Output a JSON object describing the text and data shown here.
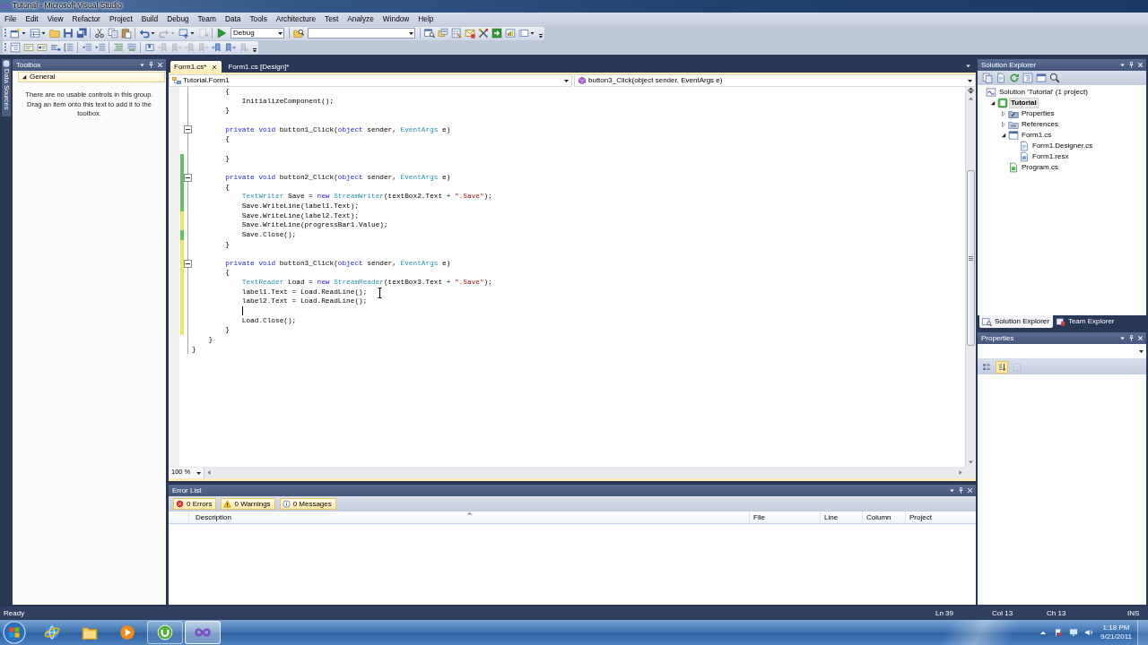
{
  "window": {
    "title": "Tutorial - Microsoft Visual Studio"
  },
  "menu": [
    "File",
    "Edit",
    "View",
    "Refactor",
    "Project",
    "Build",
    "Debug",
    "Team",
    "Data",
    "Tools",
    "Architecture",
    "Test",
    "Analyze",
    "Window",
    "Help"
  ],
  "toolbars": [
    {
      "items": [
        {
          "kind": "button",
          "dropdown": true,
          "disabled": false
        },
        {
          "kind": "button",
          "dropdown": true,
          "disabled": false
        },
        {
          "kind": "button",
          "dropdown": false,
          "disabled": false
        },
        {
          "kind": "button",
          "dropdown": false,
          "disabled": false
        },
        {
          "kind": "button",
          "dropdown": false,
          "disabled": false
        },
        {
          "kind": "separator"
        },
        {
          "kind": "button",
          "dropdown": false,
          "disabled": false
        },
        {
          "kind": "button",
          "dropdown": false,
          "disabled": false
        },
        {
          "kind": "button",
          "dropdown": false,
          "disabled": false
        },
        {
          "kind": "separator"
        },
        {
          "kind": "button",
          "dropdown": true,
          "disabled": false
        },
        {
          "kind": "button",
          "dropdown": true,
          "disabled": true
        },
        {
          "kind": "button",
          "dropdown": true,
          "disabled": false
        },
        {
          "kind": "button",
          "dropdown": false,
          "disabled": true
        },
        {
          "kind": "separator"
        },
        {
          "kind": "button",
          "dropdown": false,
          "disabled": false
        },
        {
          "kind": "combo",
          "value": "Debug"
        },
        {
          "kind": "separator"
        },
        {
          "kind": "button",
          "dropdown": false,
          "disabled": false
        },
        {
          "kind": "combo"
        },
        {
          "kind": "separator"
        },
        {
          "kind": "button",
          "dropdown": false,
          "disabled": false
        },
        {
          "kind": "button",
          "dropdown": false,
          "disabled": false
        },
        {
          "kind": "button",
          "dropdown": false,
          "disabled": false
        },
        {
          "kind": "button",
          "dropdown": false,
          "disabled": false
        },
        {
          "kind": "button",
          "dropdown": false,
          "disabled": false
        },
        {
          "kind": "button",
          "dropdown": false,
          "disabled": false
        },
        {
          "kind": "button",
          "dropdown": false,
          "disabled": false
        },
        {
          "kind": "button",
          "dropdown": true,
          "disabled": false
        },
        {
          "kind": "overflow"
        }
      ]
    },
    {
      "items": [
        {
          "kind": "button",
          "dropdown": false,
          "disabled": false
        },
        {
          "kind": "button",
          "dropdown": false,
          "disabled": false
        },
        {
          "kind": "button",
          "dropdown": false,
          "disabled": false
        },
        {
          "kind": "button",
          "dropdown": false,
          "disabled": false
        },
        {
          "kind": "button",
          "dropdown": false,
          "disabled": false
        },
        {
          "kind": "separator"
        },
        {
          "kind": "button",
          "dropdown": false,
          "disabled": false
        },
        {
          "kind": "button",
          "dropdown": false,
          "disabled": false
        },
        {
          "kind": "separator"
        },
        {
          "kind": "button",
          "dropdown": false,
          "disabled": false
        },
        {
          "kind": "button",
          "dropdown": false,
          "disabled": false
        },
        {
          "kind": "separator"
        },
        {
          "kind": "button",
          "dropdown": false,
          "disabled": false
        },
        {
          "kind": "button",
          "dropdown": false,
          "disabled": true
        },
        {
          "kind": "button",
          "dropdown": false,
          "disabled": true
        },
        {
          "kind": "button",
          "dropdown": false,
          "disabled": true
        },
        {
          "kind": "button",
          "dropdown": false,
          "disabled": true
        },
        {
          "kind": "button",
          "dropdown": false,
          "disabled": false
        },
        {
          "kind": "button",
          "dropdown": false,
          "disabled": false
        },
        {
          "kind": "button",
          "dropdown": false,
          "disabled": true
        },
        {
          "kind": "overflow"
        }
      ]
    }
  ],
  "left_dock": {
    "tabs": [
      "Data Sources"
    ]
  },
  "toolbox": {
    "title": "Toolbox",
    "groups": [
      {
        "label": "General",
        "expanded": true,
        "message": "There are no usable controls in this group. Drag an item onto this text to add it to the toolbox."
      }
    ]
  },
  "editor": {
    "tabs": [
      {
        "label": "Form1.cs*",
        "selected": true
      },
      {
        "label": "Form1.cs [Design]*",
        "selected": false
      }
    ],
    "type_selector": "Tutorial.Form1",
    "member_selector": "button3_Click(object sender, EventArgs e)",
    "lines": [
      {
        "tokens": [
          {
            "text": "        {",
            "kind": "plain"
          }
        ],
        "fold": false,
        "caret": false
      },
      {
        "tokens": [
          {
            "text": "            InitializeComponent();",
            "kind": "plain"
          }
        ],
        "fold": false,
        "caret": false
      },
      {
        "tokens": [
          {
            "text": "        }",
            "kind": "plain"
          }
        ],
        "fold": false,
        "caret": false
      },
      {
        "fold": false,
        "caret": false
      },
      {
        "tokens": [
          {
            "text": "        private void",
            "kind": "keyword"
          },
          {
            "text": " button1_Click(",
            "kind": "plain"
          },
          {
            "text": "object",
            "kind": "keyword"
          },
          {
            "text": " sender, ",
            "kind": "plain"
          },
          {
            "text": "EventArgs",
            "kind": "type"
          },
          {
            "text": " e)",
            "kind": "plain"
          }
        ],
        "fold": true,
        "caret": false
      },
      {
        "tokens": [
          {
            "text": "        {",
            "kind": "plain"
          }
        ],
        "fold": false,
        "caret": false
      },
      {
        "fold": false,
        "caret": false
      },
      {
        "tokens": [
          {
            "text": "        }",
            "kind": "plain"
          }
        ],
        "color": "#5fc561",
        "fold": false,
        "caret": false
      },
      {
        "color": "#5fc561",
        "fold": false,
        "caret": false
      },
      {
        "tokens": [
          {
            "text": "        private void",
            "kind": "keyword"
          },
          {
            "text": " button2_Click(",
            "kind": "plain"
          },
          {
            "text": "object",
            "kind": "keyword"
          },
          {
            "text": " sender, ",
            "kind": "plain"
          },
          {
            "text": "EventArgs",
            "kind": "type"
          },
          {
            "text": " e)",
            "kind": "plain"
          }
        ],
        "color": "#5fc561",
        "fold": true,
        "caret": false
      },
      {
        "tokens": [
          {
            "text": "        {",
            "kind": "plain"
          }
        ],
        "color": "#5fc561",
        "fold": false,
        "caret": false
      },
      {
        "tokens": [
          {
            "text": "            TextWriter",
            "kind": "type"
          },
          {
            "text": " Save = ",
            "kind": "plain"
          },
          {
            "text": "new",
            "kind": "keyword"
          },
          {
            "text": " StreamWriter",
            "kind": "type"
          },
          {
            "text": "(textBox2.Text + ",
            "kind": "plain"
          },
          {
            "text": "\".Save\"",
            "kind": "string"
          },
          {
            "text": ");",
            "kind": "plain"
          }
        ],
        "color": "#5fc561",
        "fold": false,
        "caret": false
      },
      {
        "tokens": [
          {
            "text": "            Save.WriteLine(label1.Text);",
            "kind": "plain"
          }
        ],
        "color": "#5fc561",
        "fold": false,
        "caret": false
      },
      {
        "tokens": [
          {
            "text": "            Save.WriteLine(label2.Text);",
            "kind": "plain"
          }
        ],
        "color": "#ede66b",
        "fold": false,
        "caret": false
      },
      {
        "tokens": [
          {
            "text": "            Save.WriteLine(progressBar1.Value);",
            "kind": "plain"
          }
        ],
        "color": "#ede66b",
        "fold": false,
        "caret": false
      },
      {
        "tokens": [
          {
            "text": "            Save.Close();",
            "kind": "plain"
          }
        ],
        "color": "#5fc561",
        "fold": false,
        "caret": false
      },
      {
        "tokens": [
          {
            "text": "        }",
            "kind": "plain"
          }
        ],
        "color": "#ede66b",
        "fold": false,
        "caret": false
      },
      {
        "color": "#ede66b",
        "fold": false,
        "caret": false
      },
      {
        "tokens": [
          {
            "text": "        private void",
            "kind": "keyword"
          },
          {
            "text": " button3_Click(",
            "kind": "plain"
          },
          {
            "text": "object",
            "kind": "keyword"
          },
          {
            "text": " sender, ",
            "kind": "plain"
          },
          {
            "text": "EventArgs",
            "kind": "type"
          },
          {
            "text": " e)",
            "kind": "plain"
          }
        ],
        "color": "#ede66b",
        "fold": true,
        "caret": false
      },
      {
        "tokens": [
          {
            "text": "        {",
            "kind": "plain"
          }
        ],
        "color": "#ede66b",
        "fold": false,
        "caret": false
      },
      {
        "tokens": [
          {
            "text": "            TextReader",
            "kind": "type"
          },
          {
            "text": " Load = ",
            "kind": "plain"
          },
          {
            "text": "new",
            "kind": "keyword"
          },
          {
            "text": " StreamReader",
            "kind": "type"
          },
          {
            "text": "(textBox3.Text + ",
            "kind": "plain"
          },
          {
            "text": "\".Save\"",
            "kind": "string"
          },
          {
            "text": ");",
            "kind": "plain"
          }
        ],
        "color": "#ede66b",
        "fold": false,
        "caret": false
      },
      {
        "tokens": [
          {
            "text": "            label1.Text = Load.ReadLine();",
            "kind": "plain"
          }
        ],
        "color": "#ede66b",
        "fold": false,
        "caret": false
      },
      {
        "tokens": [
          {
            "text": "            label2.Text = Load.ReadLine();",
            "kind": "plain"
          }
        ],
        "color": "#ede66b",
        "fold": false,
        "caret": false
      },
      {
        "color": "#ede66b",
        "fold": false,
        "caret": true
      },
      {
        "tokens": [
          {
            "text": "            Load.Close();",
            "kind": "plain"
          }
        ],
        "color": "#ede66b",
        "fold": false,
        "caret": false
      },
      {
        "tokens": [
          {
            "text": "        }",
            "kind": "plain"
          }
        ],
        "color": "#ede66b",
        "fold": false,
        "caret": false
      },
      {
        "tokens": [
          {
            "text": "    }",
            "kind": "plain"
          }
        ],
        "fold": false,
        "caret": false
      },
      {
        "tokens": [
          {
            "text": "}",
            "kind": "plain"
          }
        ],
        "fold": false,
        "caret": false
      }
    ],
    "zoom": "100 %"
  },
  "error_list": {
    "title": "Error List",
    "filters": [
      {
        "label": "0 Errors",
        "kind": "error",
        "on": true
      },
      {
        "label": "0 Warnings",
        "kind": "warning",
        "on": true
      },
      {
        "label": "0 Messages",
        "kind": "message",
        "on": true
      }
    ],
    "columns": [
      {
        "label": "Description",
        "sorted": true
      },
      {
        "label": "File",
        "sorted": false
      },
      {
        "label": "Line",
        "sorted": false
      },
      {
        "label": "Column",
        "sorted": false
      },
      {
        "label": "Project",
        "sorted": false
      }
    ]
  },
  "solution_explorer": {
    "title": "Solution Explorer",
    "tree": [
      {
        "label": "Solution 'Tutorial' (1 project)",
        "kind": "solution",
        "selected": false,
        "children": [
          {
            "label": "Tutorial",
            "kind": "project",
            "selected": true,
            "expanded": true,
            "children": [
              {
                "label": "Properties",
                "kind": "properties",
                "selected": false,
                "expanded": false
              },
              {
                "label": "References",
                "kind": "references",
                "selected": false,
                "expanded": false
              },
              {
                "label": "Form1.cs",
                "kind": "form",
                "selected": false,
                "expanded": true,
                "children": [
                  {
                    "label": "Form1.Designer.cs",
                    "kind": "code",
                    "selected": false
                  },
                  {
                    "label": "Form1.resx",
                    "kind": "resource",
                    "selected": false
                  }
                ]
              },
              {
                "label": "Program.cs",
                "kind": "csharp",
                "selected": false
              }
            ]
          }
        ]
      }
    ],
    "tabs": [
      {
        "label": "Solution Explorer",
        "selected": true
      },
      {
        "label": "Team Explorer",
        "selected": false
      }
    ]
  },
  "properties": {
    "title": "Properties",
    "toolbar": [
      {
        "kind": "categorized",
        "selected": false,
        "disabled": false
      },
      {
        "kind": "alphabetical",
        "selected": true,
        "disabled": false
      },
      {
        "kind": "pages",
        "selected": false,
        "disabled": true
      }
    ]
  },
  "status_bar": {
    "message": "Ready",
    "line": "Ln 39",
    "column": "Col 13",
    "char": "Ch 13",
    "mode": "INS"
  },
  "taskbar": {
    "apps": [
      {
        "kind": "browser",
        "running": false,
        "selected": false
      },
      {
        "kind": "folder",
        "running": false,
        "selected": false
      },
      {
        "kind": "media",
        "running": false,
        "selected": false
      },
      {
        "kind": "torrent",
        "running": true,
        "selected": false
      },
      {
        "kind": "ide",
        "running": true,
        "selected": true
      }
    ],
    "time": "1:18 PM",
    "date": "9/21/2011"
  }
}
